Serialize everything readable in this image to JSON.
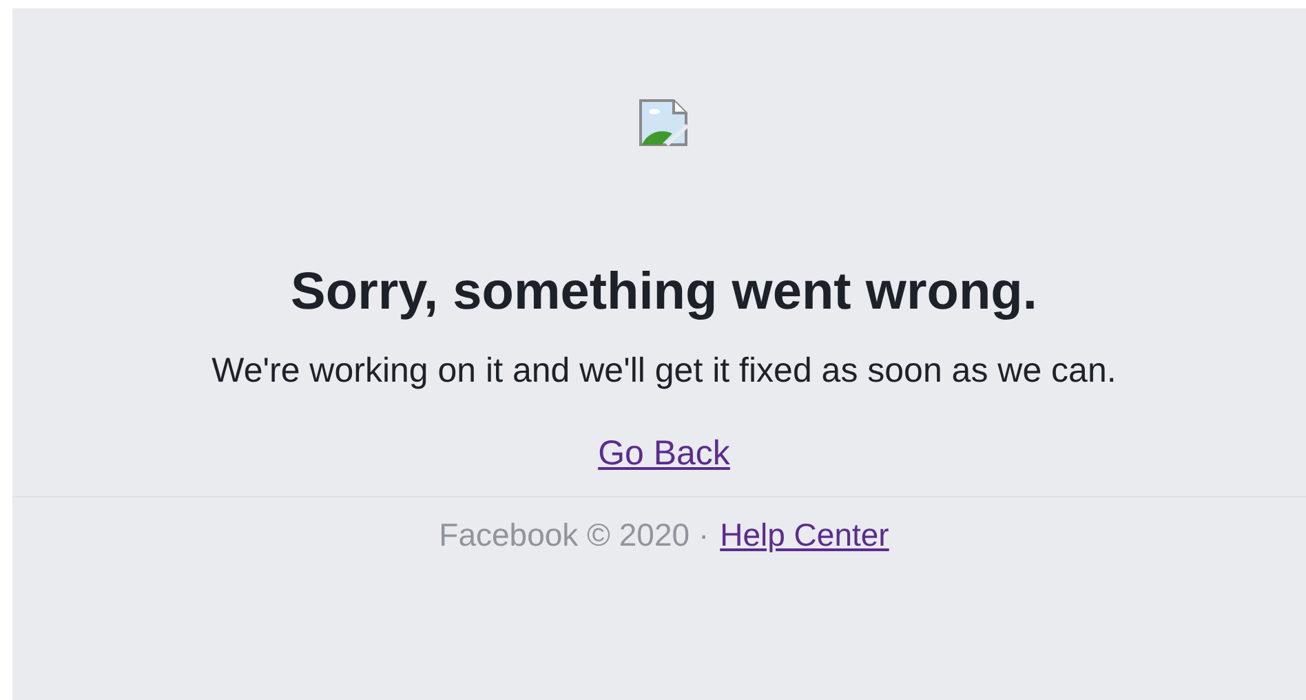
{
  "error": {
    "title": "Sorry, something went wrong.",
    "message": "We're working on it and we'll get it fixed as soon as we can.",
    "back_link": "Go Back"
  },
  "footer": {
    "copyright": "Facebook © 2020 ·",
    "link": "Help Center"
  }
}
